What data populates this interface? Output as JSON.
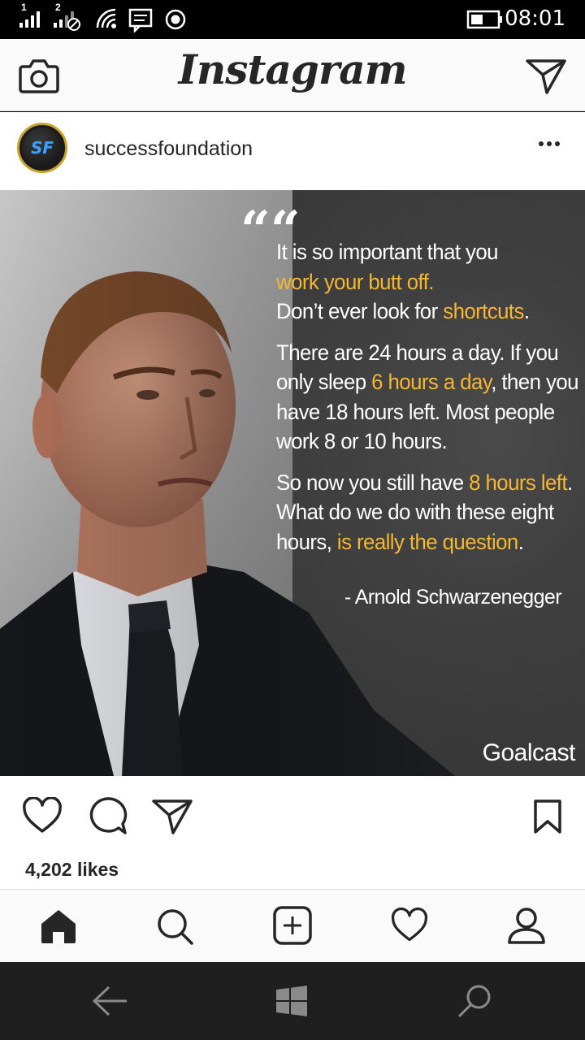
{
  "status_bar": {
    "sim1": "1",
    "sim2": "2",
    "time": "08:01",
    "icons": [
      "signal-sim1-icon",
      "signal-sim2-icon",
      "wifi-icon",
      "message-icon",
      "record-icon",
      "battery-icon"
    ]
  },
  "header": {
    "logo": "Instagram",
    "icons": [
      "camera-icon",
      "direct-message-icon"
    ]
  },
  "post": {
    "username": "successfoundation",
    "avatar_text": "SF",
    "quote_mark": "““",
    "quote": {
      "p1": {
        "l1": "It is so important that you",
        "l2_hl": "work your butt off.",
        "l3_a": "Don’t ever look for ",
        "l3_hl": "shortcuts",
        "l3_b": "."
      },
      "p2": {
        "l1": "There are 24 hours a day. If you",
        "l2_a": "only sleep ",
        "l2_hl": "6 hours a day",
        "l2_b": ", then you",
        "l3": "have 18 hours left. Most people",
        "l4": "work 8 or 10 hours."
      },
      "p3": {
        "l1_a": "So now you still have ",
        "l1_hl": "8 hours left",
        "l1_b": ".",
        "l2": "What do we do with these eight",
        "l3_a": "hours, ",
        "l3_hl": "is really the question",
        "l3_b": "."
      }
    },
    "author": "- Arnold Schwarzenegger",
    "watermark": "Goalcast",
    "likes": "4,202 likes"
  },
  "colors": {
    "highlight": "#f5b731",
    "text": "#262626",
    "background": "#fafafa"
  },
  "bottom_nav": [
    "home-icon",
    "search-icon",
    "add-post-icon",
    "activity-heart-icon",
    "profile-icon"
  ],
  "system_bar": [
    "back-icon",
    "windows-start-icon",
    "system-search-icon"
  ]
}
